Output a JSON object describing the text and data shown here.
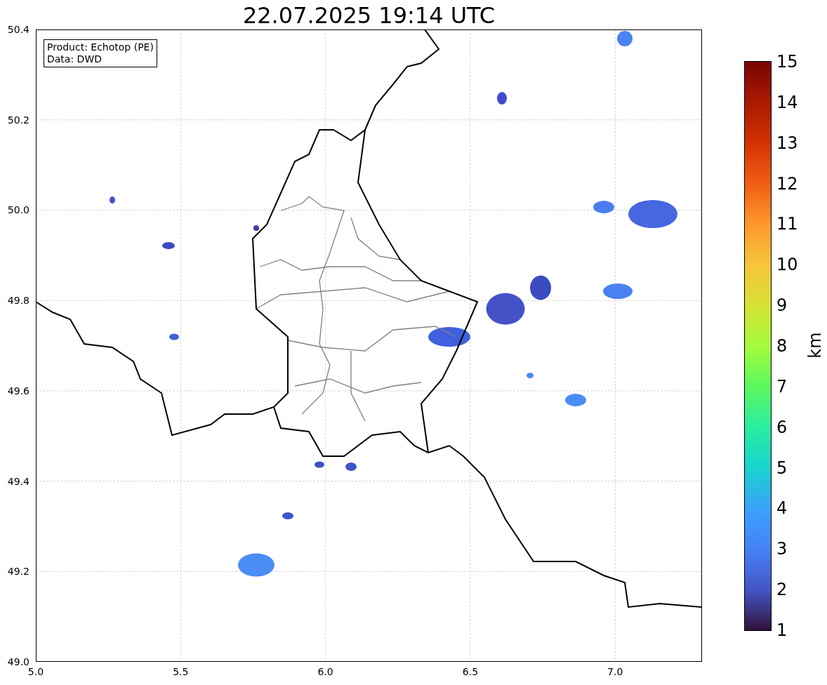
{
  "title": "22.07.2025 19:14 UTC",
  "info_box": {
    "lines": [
      "Product: Echotop (PE)",
      "Data: DWD"
    ]
  },
  "map": {
    "x_ticks": [
      "5.0",
      "5.5",
      "6.0",
      "6.5",
      "7.0"
    ],
    "y_ticks": [
      "50.4",
      "50.2",
      "50.0",
      "49.8",
      "49.6",
      "49.4",
      "49.2",
      "49.0"
    ]
  },
  "colorbar": {
    "ticks": [
      "15",
      "14",
      "13",
      "12",
      "11",
      "10",
      "9",
      "8",
      "7",
      "6",
      "5",
      "4",
      "3",
      "2",
      "1"
    ],
    "label": "km"
  }
}
